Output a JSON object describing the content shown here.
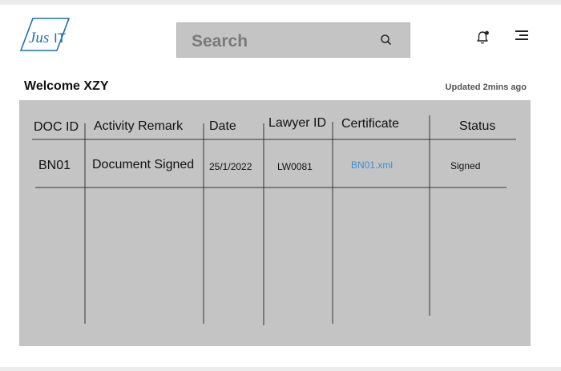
{
  "brand": {
    "logo_text": "JusIT"
  },
  "search": {
    "placeholder": "Search"
  },
  "icons": {
    "search": "search-icon",
    "notifications": "bell-icon",
    "menu": "hamburger-menu-icon"
  },
  "welcome": {
    "text": "Welcome XZY",
    "updated": "Updated 2mins ago"
  },
  "table": {
    "columns": [
      "DOC ID",
      "Activity Remark",
      "Date",
      "Lawyer ID",
      "Certificate",
      "Status"
    ],
    "rows": [
      {
        "doc_id": "BN01",
        "activity": "Document Signed",
        "date": "25/1/2022",
        "lawyer_id": "LW0081",
        "certificate": "BN01.xml",
        "status": "Signed"
      }
    ]
  },
  "colors": {
    "panel": "#c4c4c4",
    "link": "#3d8fd0"
  }
}
